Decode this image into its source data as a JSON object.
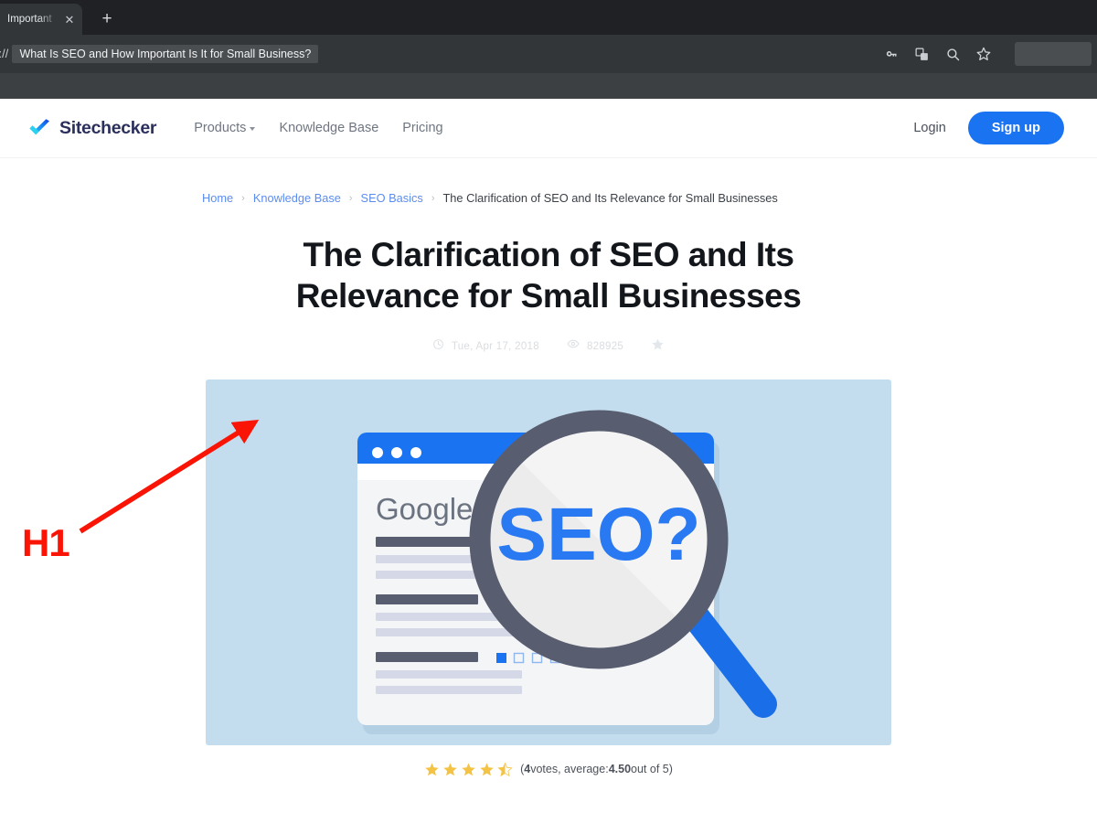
{
  "browser": {
    "tab": {
      "title": "Important",
      "close_icon": "close-icon"
    },
    "new_tab_label": "+",
    "url_scheme": "s://",
    "url_value": "What Is SEO and How Important Is It for Small Business?",
    "toolbar_icons": [
      "key-icon",
      "translate-icon",
      "search-icon",
      "bookmark-star-icon"
    ]
  },
  "site": {
    "logo_text": "Sitechecker",
    "nav": [
      {
        "label": "Products",
        "has_caret": true
      },
      {
        "label": "Knowledge Base",
        "has_caret": false
      },
      {
        "label": "Pricing",
        "has_caret": false
      }
    ],
    "login_label": "Login",
    "signup_label": "Sign up"
  },
  "breadcrumb": {
    "items": [
      "Home",
      "Knowledge Base",
      "SEO Basics"
    ],
    "current": "The Clarification of SEO and Its Relevance for Small Businesses",
    "separator": "›"
  },
  "article": {
    "title": "The Clarification of SEO and Its Relevance for Small Businesses",
    "date": "Tue, Apr 17, 2018",
    "views": "828925",
    "date_icon": "clock-icon",
    "views_icon": "eye-icon",
    "favorite_icon": "star-icon"
  },
  "hero": {
    "browser_label": "Google",
    "magnifier_label": "SEO?",
    "pagination_count": 6,
    "pagination_active_index": 0,
    "result_groups": 3
  },
  "rating": {
    "stars_filled": 4,
    "half_star": true,
    "text_prefix": "(",
    "votes": "4",
    "votes_label": "votes, average:",
    "average": "4.50",
    "suffix": "out of 5)"
  },
  "annotation": {
    "label": "H1",
    "arrow_color": "#fa1405"
  },
  "colors": {
    "brand_blue": "#1a73f0",
    "link_blue": "#5b8def",
    "logo_navy": "#2b2f5c",
    "hero_bg": "#c3dcee",
    "star_gold": "#f5c343",
    "annotation_red": "#fa1405",
    "chrome_dark": "#323639",
    "tabstrip_dark": "#202124"
  }
}
